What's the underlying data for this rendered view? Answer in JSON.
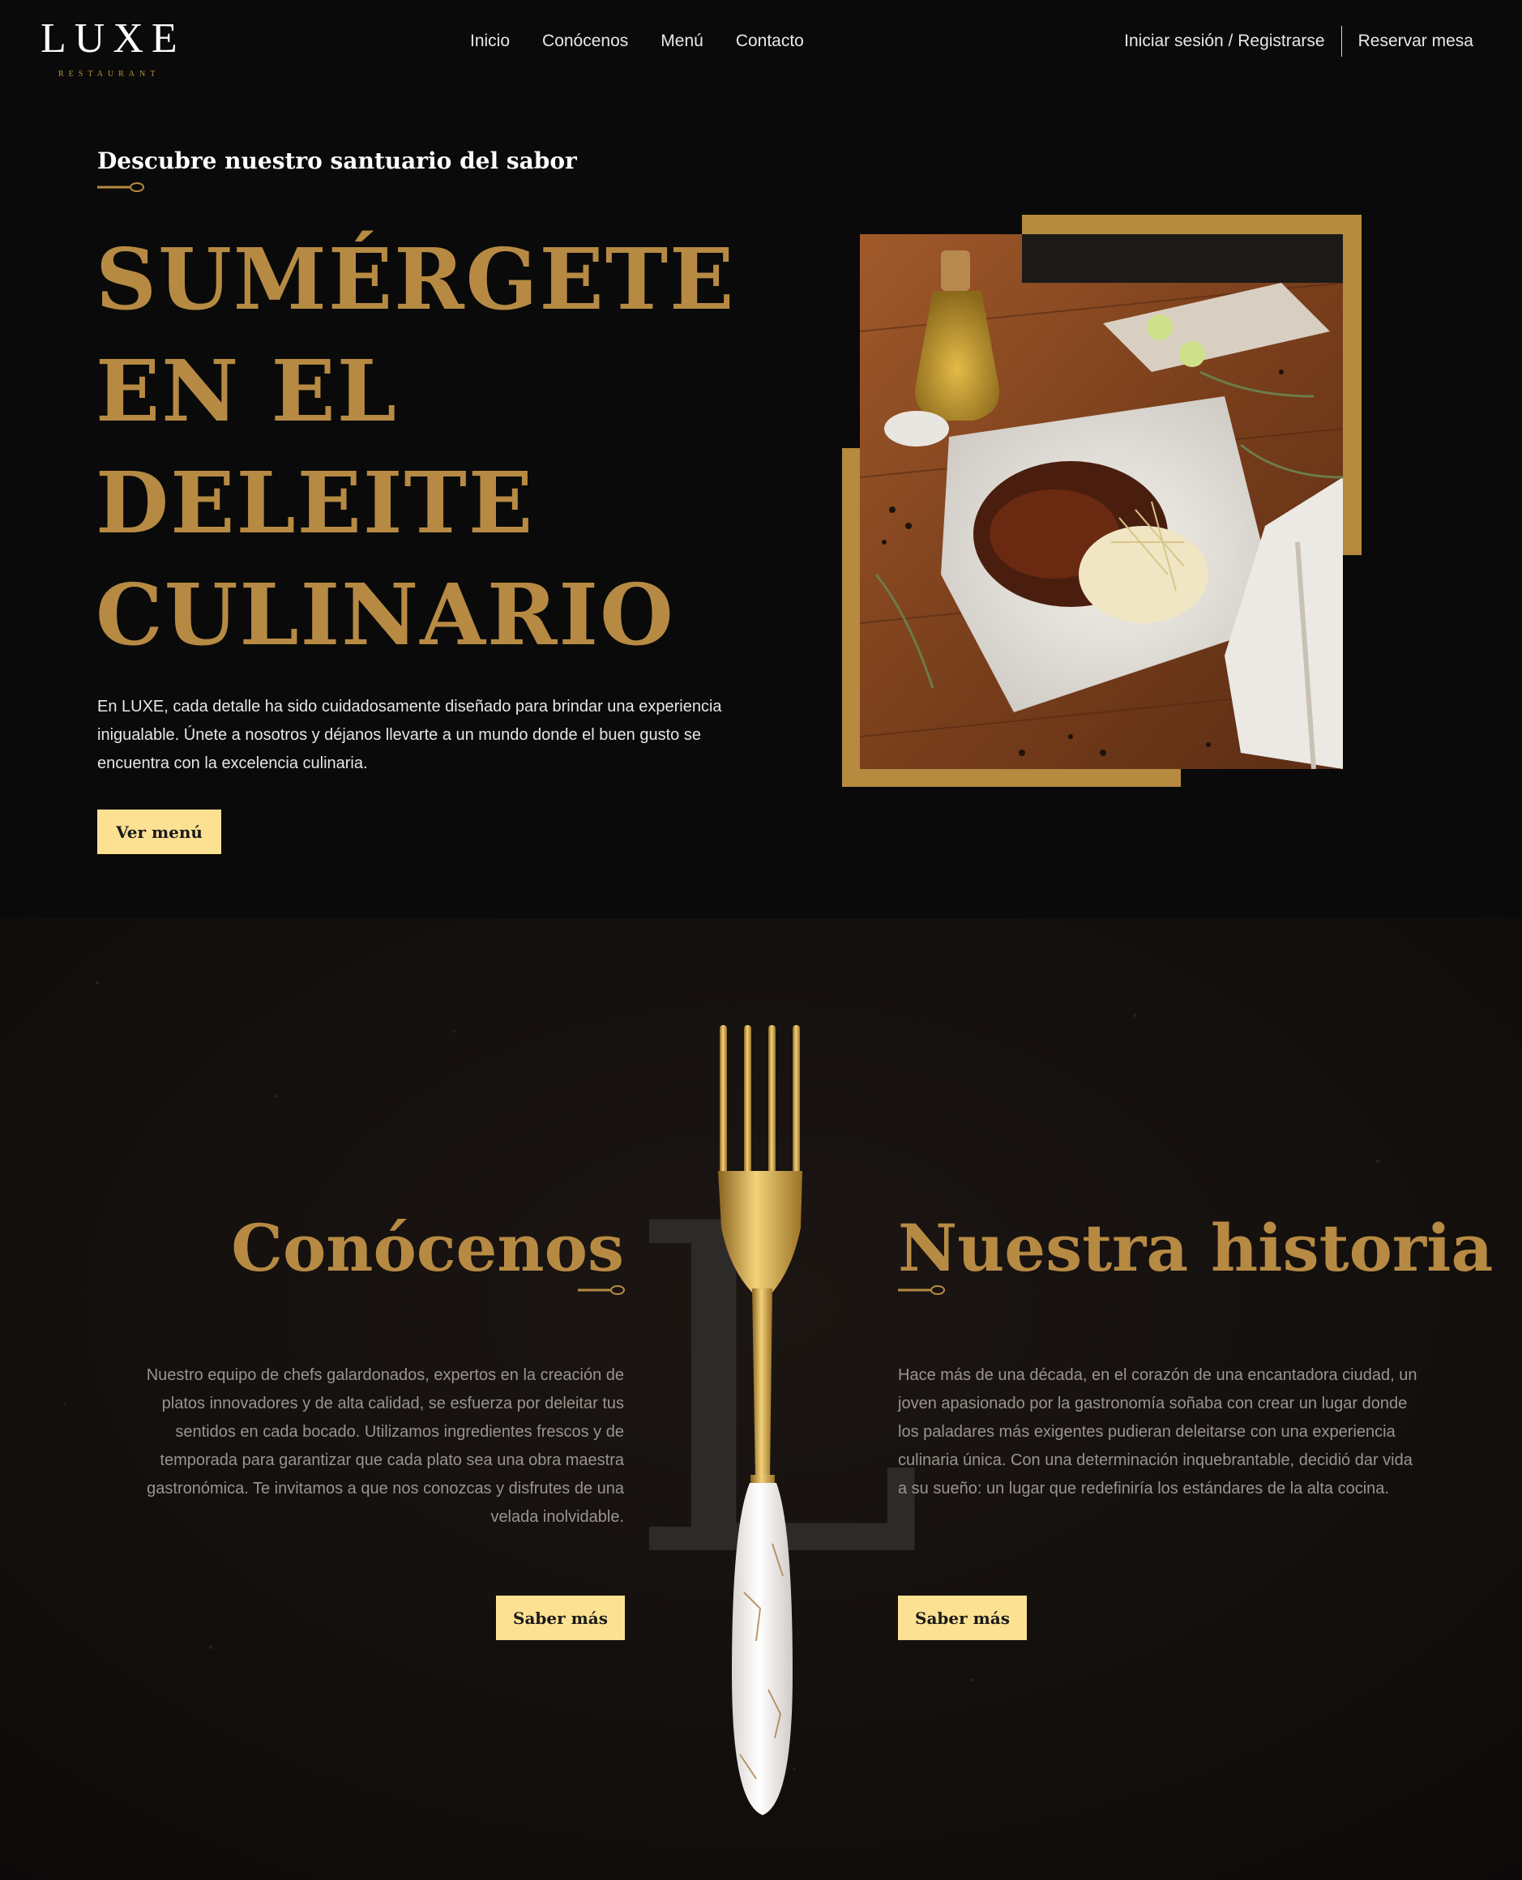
{
  "nav": {
    "logo": "LUXE",
    "logo_sub": "RESTAURANT",
    "links": [
      "Inicio",
      "Conócenos",
      "Menú",
      "Contacto"
    ],
    "login": "Iniciar sesión / Registrarse",
    "reserve": "Reservar mesa"
  },
  "hero": {
    "eyebrow": "Descubre nuestro santuario del sabor",
    "title_lines": [
      "SUMÉRGETE",
      "EN EL",
      "DELEITE",
      "CULINARIO"
    ],
    "text": "En LUXE, cada detalle ha sido cuidadosamente diseñado para brindar una experiencia inigualable. Únete a nosotros y déjanos llevarte a un mundo donde el buen gusto se encuentra con la excelencia culinaria.",
    "button": "Ver menú"
  },
  "about": {
    "decor_letter": "L",
    "left": {
      "title": "Conócenos",
      "text": "Nuestro equipo de chefs galardonados, expertos en la creación de platos innovadores y de alta calidad, se esfuerza por deleitar tus sentidos en cada bocado. Utilizamos ingredientes frescos y de temporada para garantizar que cada plato sea una obra maestra gastronómica. Te invitamos a que nos conozcas y disfrutes de una velada inolvidable.",
      "button": "Saber más"
    },
    "right": {
      "title": "Nuestra historia",
      "text": "Hace más de una década, en el corazón de una encantadora ciudad, un joven apasionado por la gastronomía soñaba con crear un lugar donde los paladares más exigentes pudieran deleitarse con una experiencia culinaria única. Con una determinación inquebrantable, decidió dar vida a su sueño: un lugar que redefiniría los estándares de la alta cocina.",
      "button": "Saber más"
    }
  },
  "colors": {
    "background": "#0a0a0a",
    "gold": "#b78a43",
    "button": "#fde192",
    "about_bg": "#130f0c"
  }
}
